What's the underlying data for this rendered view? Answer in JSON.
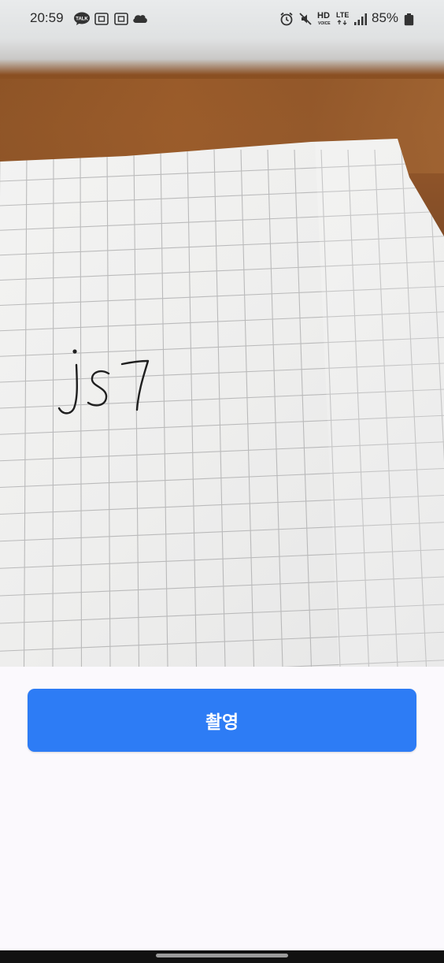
{
  "status_bar": {
    "time": "20:59",
    "battery_percent": "85%",
    "network": "LTE",
    "hd_label": "HD",
    "notification_icons": [
      "talk-icon",
      "screenshot-icon",
      "screenshot-icon",
      "cloud-icon"
    ],
    "system_icons": [
      "alarm-icon",
      "mute-icon",
      "hd-voice-icon",
      "lte-icon",
      "signal-icon",
      "battery-icon"
    ]
  },
  "preview": {
    "handwritten_text": "js7"
  },
  "capture_button": {
    "label": "촬영",
    "color": "#2d7cf5"
  },
  "colors": {
    "panel_background": "#fbf9fd",
    "nav_bar": "#111111"
  }
}
